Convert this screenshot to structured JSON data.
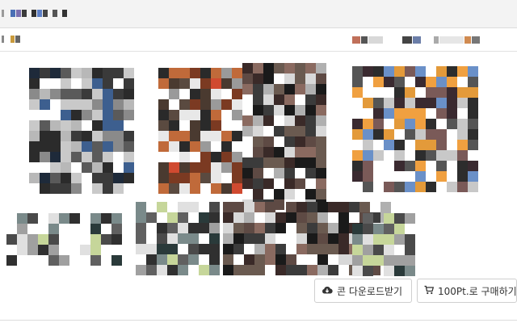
{
  "actions": {
    "download_label": "콘 다운로드받기",
    "buy_label": "100Pt.로 구매하기"
  },
  "icons": {
    "download": "cloud-download-icon",
    "buy": "cart-icon"
  }
}
